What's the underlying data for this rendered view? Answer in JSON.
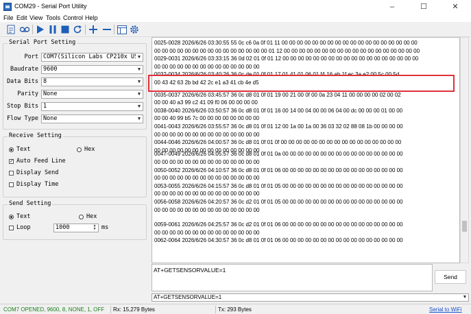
{
  "window": {
    "title": "COM29 - Serial Port Utility",
    "controls": {
      "minimize": "–",
      "maximize": "☐",
      "close": "✕"
    }
  },
  "menu": [
    "File",
    "Edit",
    "View",
    "Tools",
    "Control",
    "Help"
  ],
  "toolbar": {
    "icons": [
      "document-icon",
      "record-icon",
      "play-icon",
      "pause-icon",
      "stop-icon",
      "refresh-icon",
      "add-icon",
      "remove-icon",
      "window-icon",
      "settings-icon"
    ]
  },
  "serial_port_setting": {
    "title": "Serial Port Setting",
    "port": {
      "label": "Port",
      "value": "COM7(Silicon Labs CP210x USB"
    },
    "baudrate": {
      "label": "Baudrate",
      "value": "9600"
    },
    "data_bits": {
      "label": "Data Bits",
      "value": "8"
    },
    "parity": {
      "label": "Parity",
      "value": "None"
    },
    "stop_bits": {
      "label": "Stop Bits",
      "value": "1"
    },
    "flow_type": {
      "label": "Flow Type",
      "value": "None"
    }
  },
  "receive_setting": {
    "title": "Receive Setting",
    "text": {
      "label": "Text",
      "selected": true
    },
    "hex": {
      "label": "Hex",
      "selected": false
    },
    "auto_feed_line": {
      "label": "Auto Feed Line",
      "checked": true
    },
    "display_send": {
      "label": "Display Send",
      "checked": false
    },
    "display_time": {
      "label": "Display Time",
      "checked": false
    }
  },
  "send_setting": {
    "title": "Send Setting",
    "text": {
      "label": "Text",
      "selected": true
    },
    "hex": {
      "label": "Hex",
      "selected": false
    },
    "loop": {
      "label": "Loop",
      "checked": false
    },
    "interval": "1000",
    "interval_unit": "ms"
  },
  "log": {
    "lines": [
      "0025-0028 2026/6/26 03:30:55 55 0c c6 0a 0f 01 11 00 00 00 00 00 00 00 00 00 00 00 00 00 00 00 00 00 00",
      "00 00 00 00 00 00 00 00 00 00 00 00 00 00 00 01 12 00 00 00 00 00 00 00 00 00 00 00 00 00 00 00 00 00 00",
      "0029-0031 2026/6/26 03:33:15 36 0d 02 01 0f 01 12 00 00 00 00 00 00 00 00 00 00 00 00 00 00 00 00 00 00",
      "00 00 00 00 00 00 00 00 00 00 00 00 00 00",
      "0032-0034 2026/6/26 03:40:26 36 0c de 01 0f 01 17 01 41 01 06 01 f4 16 ab 1f ec 3a e2 00 5c 00 5d",
      "00 43 42 63 2b bd 42 2c e1 a3 41 cb 4e d5",
      "0035-0037 2026/6/26 03:45:57 36 0c d8 01 0f 01 19 00 21 00 0f 00 0a 23 04 11 00 00 00 00 02 00 02",
      "00 00 40 a3 99 c2 41 09 f0 06 00 00 00 00",
      "0038-0040 2026/6/26 03:50:57 36 0c d8 01 0f 01 16 00 14 00 04 00 00 06 04 00 dc 00 00 00 01 00 00",
      "00 00 40 99 b5 7c 00 00 00 00 00 00 00 00",
      "0041-0043 2026/6/26 03:55:57 36 0c d8 01 0f 01 12 00 1a 00 1a 00 36 03 32 02 88 08 1b 00 00 00 00",
      "00 00 00 00 00 00 00 00 00 00 00 00 00 00",
      "0044-0046 2026/6/26 04:00:57 36 0c d8 01 0f 01 0f 00 00 00 00 00 00 00 00 00 00 00 00 00 00 00 00",
      "00 00 00 00 00 00 00 00 00 00 00 00 00 00",
      "0047-0049 2026/6/26 04:05:57 36 0c d8 01 0f 01 0a 00 00 00 00 00 00 00 00 00 00 00 00 00 00 00 00",
      "00 00 00 00 00 00 00 00 00 00 00 00 00 00",
      "0050-0052 2026/6/26 04:10:57 36 0c d8 01 0f 01 06 00 00 00 00 00 00 00 00 00 00 00 00 00 00 00 00",
      "00 00 00 00 00 00 00 00 00 00 00 00 00 00",
      "0053-0055 2026/6/26 04:15:57 36 0c d8 01 0f 01 05 00 00 00 00 00 00 00 00 00 00 00 00 00 00 00 00",
      "00 00 00 00 00 00 00 00 00 00 00 00 00 00",
      "0056-0058 2026/6/26 04:20:57 36 0c d2 01 0f 01 05 00 00 00 00 00 00 00 00 00 00 00 00 00 00 00 00",
      "00 00 00 00 00 00 00 00 00 00 00 00 00 00",
      "0059-0061 2026/6/26 04:25:57 36 0c d2 01 0f 01 06 00 00 00 00 00 00 00 00 00 00 00 00 00 00 00 00",
      "00 00 00 00 00 00 00 00 00 00 00 00 00 00",
      "0062-0064 2026/6/26 04:30:57 36 0c d8 01 0f 01 06 00 00 00 00 00 00 00 00 00 00 00 00 00 00 00 00"
    ]
  },
  "send": {
    "input_value": "AT+GETSENSORVALUE=1",
    "button_label": "Send",
    "history_value": "AT+GETSENSORVALUE=1"
  },
  "status": {
    "connection": "COM7 OPENED, 9600, 8, NONE, 1, OFF",
    "connection_color": "#1a7f1a",
    "rx": "Rx: 15,279 Bytes",
    "tx": "Tx: 293 Bytes",
    "link": "Serial to WiFi",
    "link_color": "#1a4fd0"
  }
}
